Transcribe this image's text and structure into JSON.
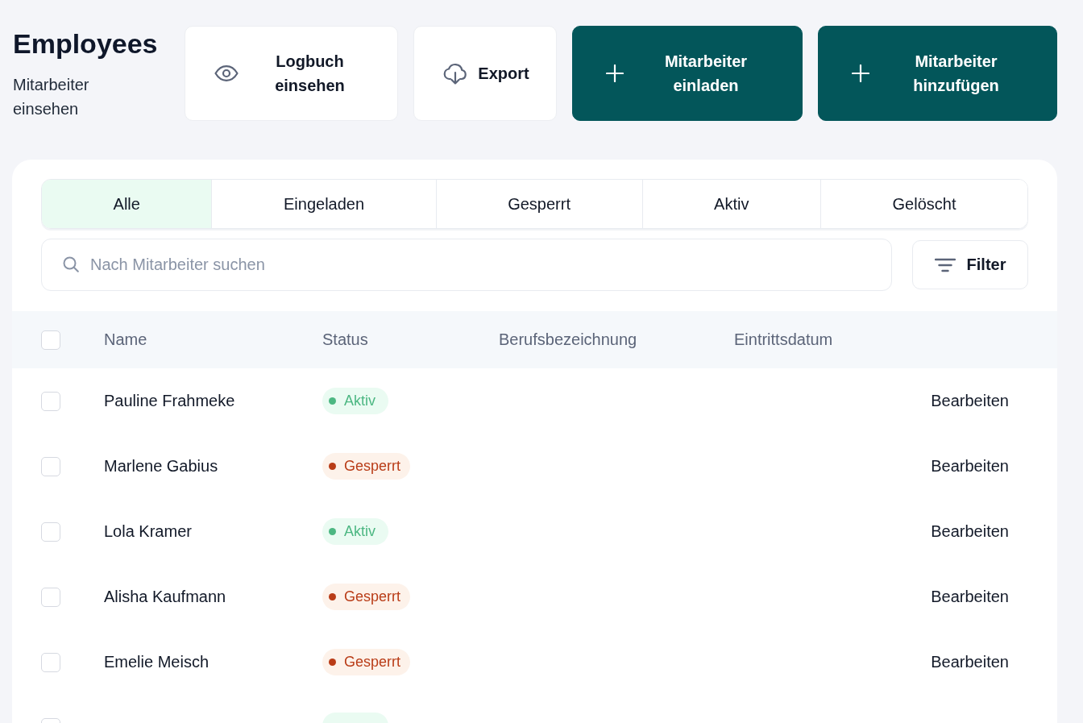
{
  "page": {
    "title": "Employees",
    "subtitle": "Mitarbeiter einsehen"
  },
  "actions": [
    {
      "kind": "log",
      "label": "Logbuch einsehen"
    },
    {
      "kind": "export",
      "label": "Export"
    },
    {
      "kind": "invite",
      "label": "Mitarbeiter einladen"
    },
    {
      "kind": "add",
      "label": "Mitarbeiter hinzufügen"
    }
  ],
  "tabs": [
    {
      "label": "Alle",
      "selected": true
    },
    {
      "label": "Eingeladen",
      "selected": false
    },
    {
      "label": "Gesperrt",
      "selected": false
    },
    {
      "label": "Aktiv",
      "selected": false
    },
    {
      "label": "Gelöscht",
      "selected": false
    }
  ],
  "search": {
    "placeholder": "Nach Mitarbeiter suchen"
  },
  "filter_button": {
    "label": "Filter"
  },
  "table": {
    "select_all": {
      "checked": false
    },
    "columns": [
      "Name",
      "Status",
      "Berufsbezeichnung",
      "Eintrittsdatum"
    ],
    "rows": [
      {
        "checked": false,
        "name": "Pauline Frahmeke",
        "status": {
          "kind": "active",
          "label": "Aktiv"
        },
        "action": "Bearbeiten"
      },
      {
        "checked": false,
        "name": "Marlene Gabius",
        "status": {
          "kind": "blocked",
          "label": "Gesperrt"
        },
        "action": "Bearbeiten"
      },
      {
        "checked": false,
        "name": "Lola Kramer",
        "status": {
          "kind": "active",
          "label": "Aktiv"
        },
        "action": "Bearbeiten"
      },
      {
        "checked": false,
        "name": "Alisha Kaufmann",
        "status": {
          "kind": "blocked",
          "label": "Gesperrt"
        },
        "action": "Bearbeiten"
      },
      {
        "checked": false,
        "name": "Emelie Meisch",
        "status": {
          "kind": "blocked",
          "label": "Gesperrt"
        },
        "action": "Bearbeiten"
      },
      {
        "checked": false,
        "status": {
          "kind": "active"
        }
      }
    ]
  }
}
